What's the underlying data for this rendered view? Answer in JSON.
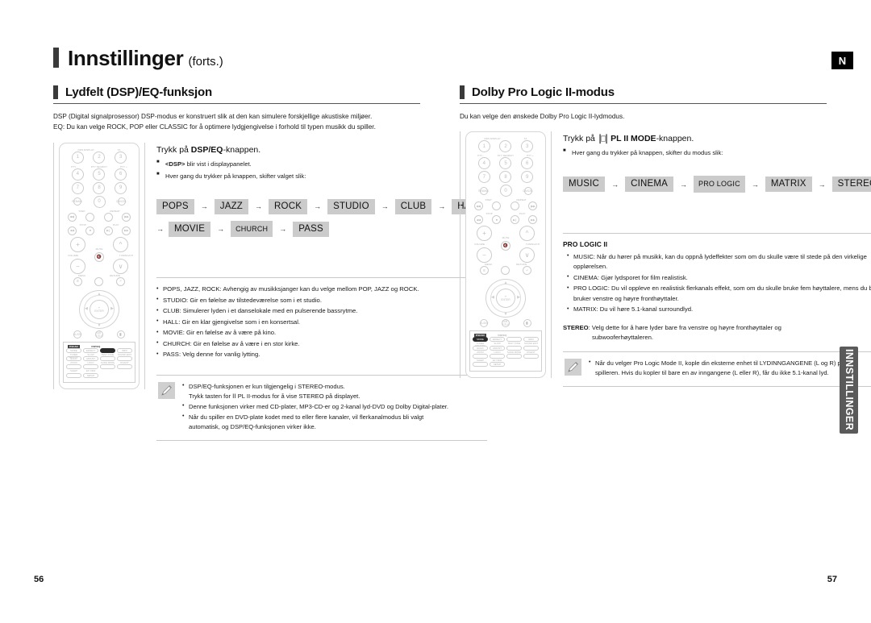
{
  "document": {
    "title_main": "Innstillinger",
    "title_sub": "(forts.)",
    "locale_badge": "N",
    "side_tab": "INNSTILLINGER",
    "page_left": "56",
    "page_right": "57"
  },
  "left": {
    "section_title": "Lydfelt (DSP)/EQ-funksjon",
    "intro_line_1": "DSP (Digital signalprosessor) DSP-modus er konstruert slik at den kan simulere forskjellige akustiske miljøer.",
    "intro_line_2": "EQ: Du kan velge ROCK, POP eller CLASSIC for å optimere lydgjengivelse i forhold til typen musikk du spiller.",
    "press_prefix": "Trykk på ",
    "press_key": "DSP/EQ",
    "press_suffix": "-knappen.",
    "bullet_1_pre": "",
    "bullet_1_key": "<DSP>",
    "bullet_1_post": " blir vist i displaypanelet.",
    "bullet_2": "Hver gang du trykker på knappen, skifter valget slik:",
    "chain_row_1": [
      "POPS",
      "JAZZ",
      "ROCK",
      "STUDIO",
      "CLUB",
      "HALL"
    ],
    "chain_row_2": [
      "MOVIE",
      "CHURCH",
      "PASS"
    ],
    "arrow": "→",
    "descriptions": [
      "POPS, JAZZ, ROCK: Avhengig av musikksjanger kan du velge mellom POP, JAZZ og ROCK.",
      "STUDIO: Gir en følelse av tilstedeværelse som i et studio.",
      "CLUB: Simulerer lyden i et danselokale med en pulserende bassrytme.",
      "HALL: Gir en klar gjengivelse som i en konsertsal.",
      "MOVIE: Gir en følelse av å være på kino.",
      "CHURCH: Gir en følelse av å være i en stor kirke.",
      "PASS: Velg denne for vanlig lytting."
    ],
    "note": {
      "item_1_a": "DSP/EQ-funksjonen er kun tilgjengelig i STEREO-modus.",
      "item_1_b": "Trykk tasten for ⅠⅠ PL II-modus for å vise STEREO på displayet.",
      "item_2": "Denne funksjonen virker med CD-plater, MP3-CD-er og 2-kanal lyd-DVD og Dolby Digital-plater.",
      "item_3_a": "Når du spiller en DVD-plate kodet med to eller flere kanaler, vil flerkanalmodus bli valgt",
      "item_3_b": "automatisk, og DSP/EQ-funksjonen virker ikke."
    }
  },
  "right": {
    "section_title": "Dolby Pro Logic II-modus",
    "intro_line_1": "Du kan velge den ønskede Dolby Pro Logic II-lydmodus.",
    "press_prefix": "Trykk på ",
    "press_key": "PL II MODE",
    "press_suffix": "-knappen.",
    "bullet_1": "Hver gang du trykker på knappen, skifter du modus slik:",
    "chain_row_1": [
      "MUSIC",
      "CINEMA",
      "PRO LOGIC",
      "MATRIX",
      "STEREO"
    ],
    "arrow": "→",
    "sub_head": "PRO LOGIC II",
    "descriptions": [
      "MUSIC: Når du hører på musikk, kan du oppnå lydeffekter som om du skulle være til stede på den virkelige opplørelsen.",
      "CINEMA: Gjør lydsporet for film realistisk.",
      "PRO LOGIC: Du vil oppleve en realistisk flerkanals effekt, som om du skulle bruke fem høyttalere, mens du bare bruker venstre og høyre fronthøyttaler.",
      "MATRIX: Du vil høre 5.1-kanal surroundlyd."
    ],
    "stereo_label": "STEREO",
    "stereo_text_1": ": Velg dette for å høre lyder bare fra venstre og høyre fronthøyttaler og",
    "stereo_text_2": "subwooferhøyttaleren.",
    "note": {
      "item_1_a": "Når du velger Pro Logic Mode II, kople din eksterne enhet til LYDINNGANGENE (L og R) på",
      "item_1_b": "spilleren. Hvis du kopler til bare en av inngangene (L eller R), får du ikke 5.1-kanal lyd."
    }
  },
  "remote": {
    "label_rds": "RDS DISPLAY",
    "label_ta": "TA",
    "label_pty_minus": "PTY -",
    "label_pty_search": "PTY SEARCH",
    "label_pty_plus": "PTY +",
    "keys_row1": [
      "1",
      "2",
      "3"
    ],
    "keys_row2": [
      "4",
      "5",
      "6"
    ],
    "keys_row3": [
      "7",
      "8",
      "9"
    ],
    "keys_row4": [
      "REMAIN",
      "0",
      "CANCEL"
    ],
    "label_step": "STEP",
    "label_repeat": "REPEAT",
    "label_stop": "STOP",
    "label_play": "PLAY",
    "transport_row1": [
      "◀◀|",
      "",
      "",
      "|▶▶"
    ],
    "transport_row2": [
      "◀◀",
      "■",
      "▶||",
      "▶▶"
    ],
    "label_volume": "VOLUME",
    "label_mute": "MUTE",
    "label_tuning": "TUNING/CH",
    "label_menu": "MENU",
    "label_return": "RETURN",
    "label_enter": "ENTER",
    "label_audio": "AUDIO",
    "label_subtitle": "SUB TITLE",
    "label_exit": "EXIT",
    "keypad_title_left": "P.SCAN",
    "keypad_title_right": "DSP/EQ",
    "keypad_rows": [
      [
        "MODE",
        "EFFECT",
        "",
        "INFO"
      ],
      [
        "TUNER MEMORY",
        "SLOW",
        "TEST TONE",
        "SOUND EDIT"
      ],
      [
        "ECHO",
        "ADJUST",
        "",
        ""
      ],
      [
        "ZOOM",
        "LOGO",
        "SLIDE MODE",
        "DIGEST"
      ],
      [
        "SLEEP",
        "EZ VIEW",
        "",
        ""
      ],
      [
        "",
        "SETUP",
        "",
        ""
      ]
    ],
    "keypad_labels": [
      [
        "",
        "",
        "",
        ""
      ],
      [
        "TUNER MEMORY",
        "SLOW",
        "TEST TONE",
        "SOUND EDIT"
      ],
      [
        "",
        "",
        "",
        ""
      ],
      [
        "ZOOM",
        "LOGO",
        "SLIDE MODE",
        "DIGEST"
      ],
      [
        "SLEEP",
        "EZ VIEW",
        "",
        ""
      ]
    ],
    "highlight_left": "DSP/EQ",
    "highlight_right": "MODE"
  }
}
